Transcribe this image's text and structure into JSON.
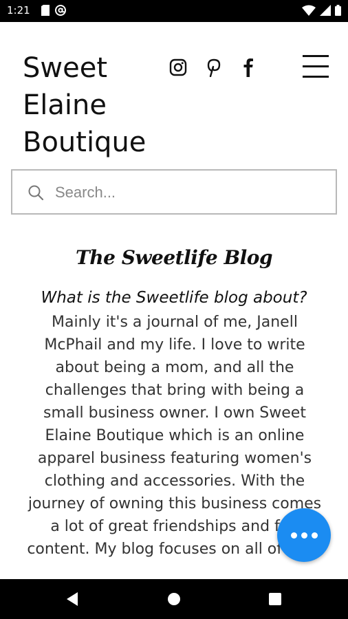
{
  "status_bar": {
    "time": "1:21",
    "left_icons": [
      "sim-card-icon",
      "at-sign-icon"
    ],
    "right_icons": [
      "wifi-icon",
      "signal-icon",
      "battery-icon"
    ]
  },
  "header": {
    "brand_lines": [
      "Sweet",
      "Elaine",
      "Boutique"
    ],
    "social_icons": [
      "instagram-icon",
      "pinterest-icon",
      "facebook-icon"
    ],
    "menu_icon": "hamburger-menu-icon"
  },
  "search": {
    "placeholder": "Search..."
  },
  "blog": {
    "title": "The Sweetlife Blog",
    "question": "What is the Sweetlife blog about?",
    "body": "Mainly it's a journal of me, Janell McPhail and my life. I love to write about being a mom, and all the challenges that bring with being a small business owner. I own Sweet Elaine Boutique which is an online apparel business featuring women's clothing and accessories. With the journey of owning this business comes a lot of great friendships and fun content. My blog focuses on all of that."
  },
  "fab": {
    "icon": "more-horizontal-icon",
    "color": "#1b8cf2"
  },
  "nav_bar": {
    "buttons": [
      "back-icon",
      "home-icon",
      "recents-icon"
    ]
  }
}
